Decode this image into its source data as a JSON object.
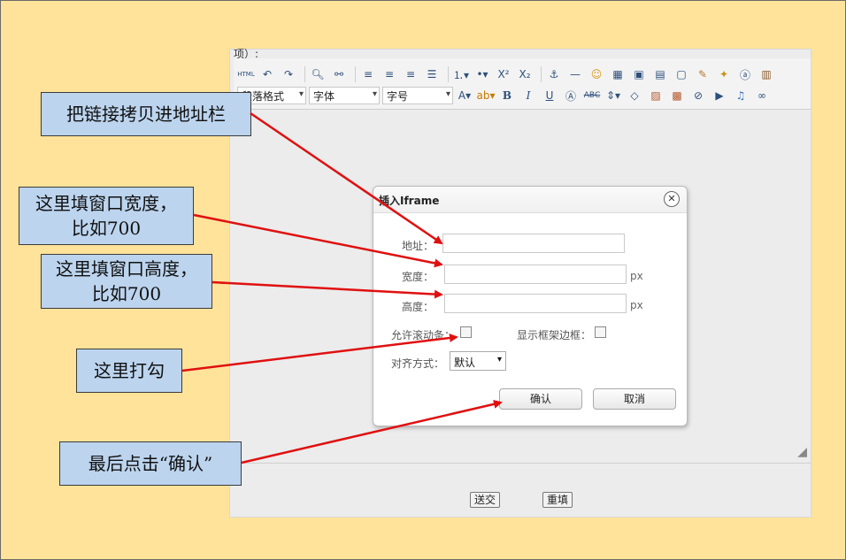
{
  "editor": {
    "top_text": "项）:",
    "toolbar": {
      "row1_icons": [
        "html-icon",
        "undo-icon",
        "redo-icon",
        "find-icon",
        "replace-icon",
        "align-left-icon",
        "align-center-icon",
        "align-right-icon",
        "align-justify-icon",
        "ordered-list-icon",
        "unordered-list-icon",
        "superscript-icon",
        "subscript-icon",
        "anchor-icon",
        "horizontal-rule-icon",
        "emoticon-icon",
        "table-icon",
        "image-icon",
        "video-icon",
        "page-icon",
        "brush-icon",
        "magic-icon",
        "letter-icon",
        "paste-icon"
      ],
      "paragraph_select": "段落格式",
      "font_select": "字体",
      "size_select": "字号"
    },
    "bottom_buttons": {
      "submit_label": "送交",
      "reset_label": "重填"
    }
  },
  "dialog": {
    "title": "插入Iframe",
    "close_symbol": "✕",
    "address_label": "地址：",
    "address_value": "",
    "width_label": "宽度：",
    "width_value": "",
    "width_unit": "px",
    "height_label": "高度：",
    "height_value": "",
    "height_unit": "px",
    "scroll_label": "允许滚动条：",
    "scroll_checked": false,
    "border_label": "显示框架边框：",
    "border_checked": false,
    "align_label": "对齐方式：",
    "align_value": "默认",
    "confirm_label": "确认",
    "cancel_label": "取消"
  },
  "callouts": {
    "c1": "把链接拷贝进地址栏",
    "c2_line1": "这里填窗口宽度，",
    "c2_line2": "比如700",
    "c3_line1": "这里填窗口高度，",
    "c3_line2": "比如700",
    "c4": "这里打勾",
    "c5": "最后点击“确认”"
  },
  "colors": {
    "background": "#ffe39a",
    "callout_fill": "#bcd4ee",
    "arrow": "#e01010"
  }
}
